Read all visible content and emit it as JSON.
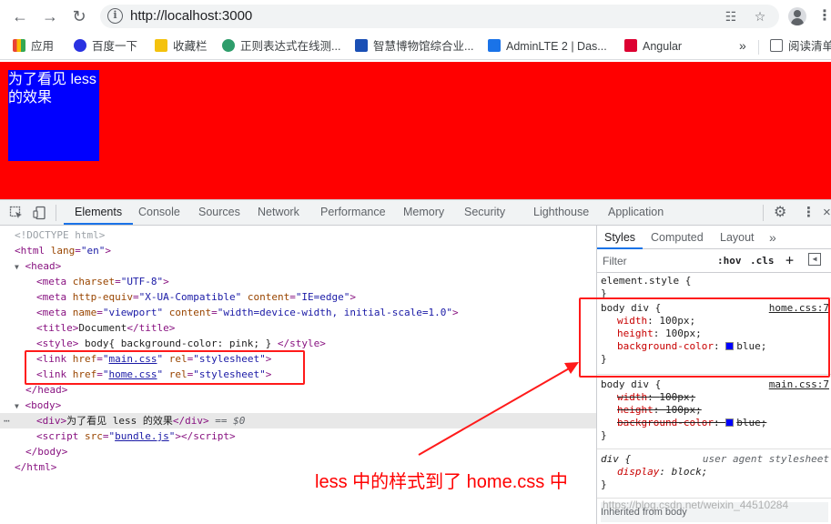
{
  "browser": {
    "url": "http://localhost:3000",
    "bookmarks": [
      {
        "label": "应用",
        "icon": "apps-grid-icon",
        "color": "#4285f4"
      },
      {
        "label": "百度一下",
        "icon": "baidu-paw-icon",
        "color": "#2932e1"
      },
      {
        "label": "收藏栏",
        "icon": "folder-icon",
        "color": "#f4c20d"
      },
      {
        "label": "正则表达式在线测...",
        "icon": "gear-flower-icon",
        "color": "#2e9d6b"
      },
      {
        "label": "智慧博物馆综合业...",
        "icon": "museum-icon",
        "color": "#1a4fb5"
      },
      {
        "label": "AdminLTE 2 | Das...",
        "icon": "adminlte-icon",
        "color": "#1a73e8"
      },
      {
        "label": "Angular",
        "icon": "angular-shield-icon",
        "color": "#dd0031"
      }
    ],
    "bookmarks_more": "»",
    "reading_list": "阅读清单"
  },
  "page": {
    "box_text": "为了看见 less 的效果",
    "background": "#ff0000",
    "box_color": "#0000ff"
  },
  "devtools": {
    "tabs": [
      "Elements",
      "Console",
      "Sources",
      "Network",
      "Performance",
      "Memory",
      "Security",
      "Lighthouse",
      "Application"
    ],
    "active_tab": "Elements",
    "dom": {
      "doctype": "<!DOCTYPE html>",
      "html_open": "<html ",
      "html_lang_attr": "lang",
      "html_lang_val": "\"en\"",
      "head_open": "<head>",
      "meta1": {
        "attr": "charset",
        "val": "\"UTF-8\""
      },
      "meta2": {
        "a1": "http-equiv",
        "v1": "\"X-UA-Compatible\"",
        "a2": "content",
        "v2": "\"IE=edge\""
      },
      "meta3": {
        "a1": "name",
        "v1": "\"viewport\"",
        "a2": "content",
        "v2": "\"width=device-width, initial-scale=1.0\""
      },
      "title_text": "Document",
      "style_text": " body{ background-color: pink; } ",
      "link1_href": "main.css",
      "link2_href": "home.css",
      "rel_val": "\"stylesheet\"",
      "head_close": "</head>",
      "body_open": "<body>",
      "div_text": "为了看见 less 的效果",
      "selected_suffix": " == $0",
      "script_src": "bundle.js",
      "body_close": "</body>",
      "html_close": "</html>"
    },
    "styles": {
      "tabs": [
        "Styles",
        "Computed",
        "Layout",
        "»"
      ],
      "active_tab": "Styles",
      "filter_placeholder": "Filter",
      "hov": ":hov",
      "cls": ".cls",
      "element_style": "element.style {",
      "rule1": {
        "selector": "body div {",
        "source": "home.css:7",
        "props": [
          {
            "name": "width",
            "value": "100px;"
          },
          {
            "name": "height",
            "value": "100px;"
          },
          {
            "name": "background-color",
            "value": "blue;"
          }
        ]
      },
      "rule2": {
        "selector": "body div {",
        "source": "main.css:7",
        "props": [
          {
            "name": "width",
            "value": "100px;"
          },
          {
            "name": "height",
            "value": "100px;"
          },
          {
            "name": "background-color",
            "value": "blue;"
          }
        ]
      },
      "rule3": {
        "selector": "div {",
        "source": "user agent stylesheet",
        "props": [
          {
            "name": "display",
            "value": "block;"
          }
        ]
      },
      "inherited": "Inherited from body",
      "close_brace": "}"
    }
  },
  "annotation": {
    "text": "less 中的样式到了 home.css 中",
    "color": "#ff0000"
  },
  "watermark": "https://blog.csdn.net/weixin_44510284"
}
